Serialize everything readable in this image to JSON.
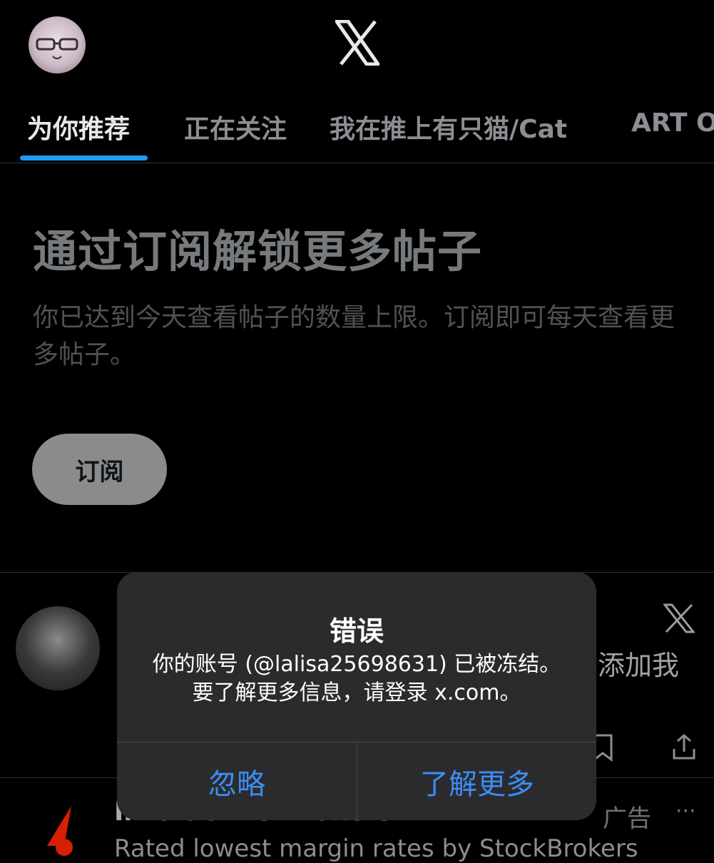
{
  "header": {
    "tabs": [
      {
        "label": "为你推荐",
        "active": true
      },
      {
        "label": "正在关注"
      },
      {
        "label": "我在推上有只猫/Cat"
      },
      {
        "label": "ART O"
      }
    ]
  },
  "paywall": {
    "title": "通过订阅解锁更多帖子",
    "description": "你已达到今天查看帖子的数量上限。订阅即可每天查看更多帖子。",
    "subscribe_label": "订阅"
  },
  "post": {
    "text_fragment": "添加我"
  },
  "ad": {
    "advertiser": "Interactive Brokers",
    "tag": "广告",
    "more": "···",
    "text": "Rated lowest margin rates by StockBrokers"
  },
  "alert": {
    "title": "错误",
    "message_line1": "你的账号 (@lalisa25698631) 已被冻结。",
    "message_line2": "要了解更多信息，请登录 x.com。",
    "dismiss_label": "忽略",
    "learn_more_label": "了解更多"
  },
  "colors": {
    "accent": "#1d9bf0",
    "alert_button": "#3b8ef5",
    "alert_background": "#2b2b2d"
  }
}
